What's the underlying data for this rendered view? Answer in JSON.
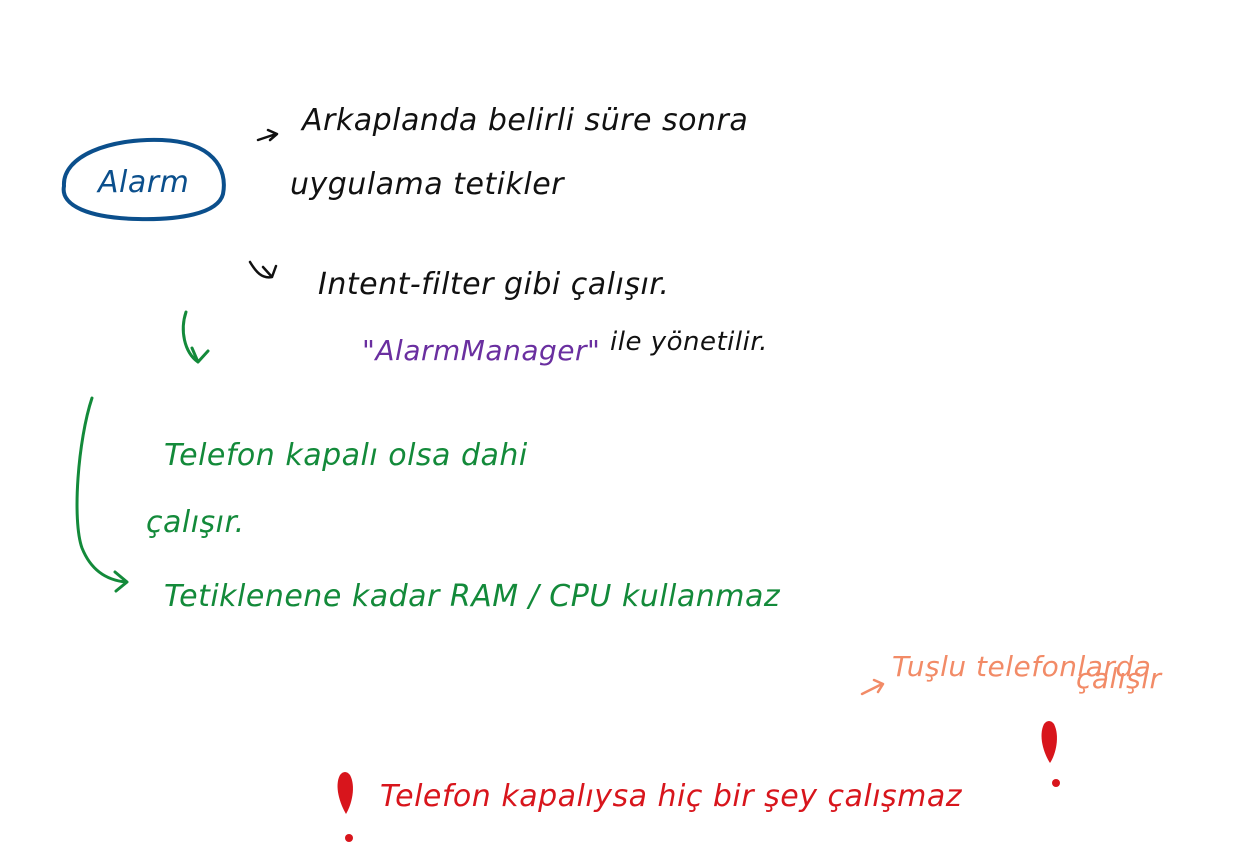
{
  "colors": {
    "black": "#111111",
    "blue": "#0b4f8c",
    "purple": "#6a2fa0",
    "green": "#138a3a",
    "orange": "#f28b67",
    "red": "#d8151c"
  },
  "notes": {
    "alarm_label": "Alarm",
    "line1": "Arkaplanda belirli süre sonra",
    "line2": "uygulama tetikler",
    "line3": "Intent-filter gibi çalışır.",
    "line4_highlight": "\"AlarmManager\"",
    "line4_rest": "ile yönetilir.",
    "green_line1": "Telefon kapalı olsa dahi",
    "green_line2": "çalışır.",
    "green_line3": "Tetiklenene kadar RAM / CPU kullanmaz",
    "orange_line1": "Tuşlu telefonlarda",
    "orange_line2": "çalışır",
    "red_line": "Telefon kapalıysa hiç bir şey çalışmaz"
  }
}
